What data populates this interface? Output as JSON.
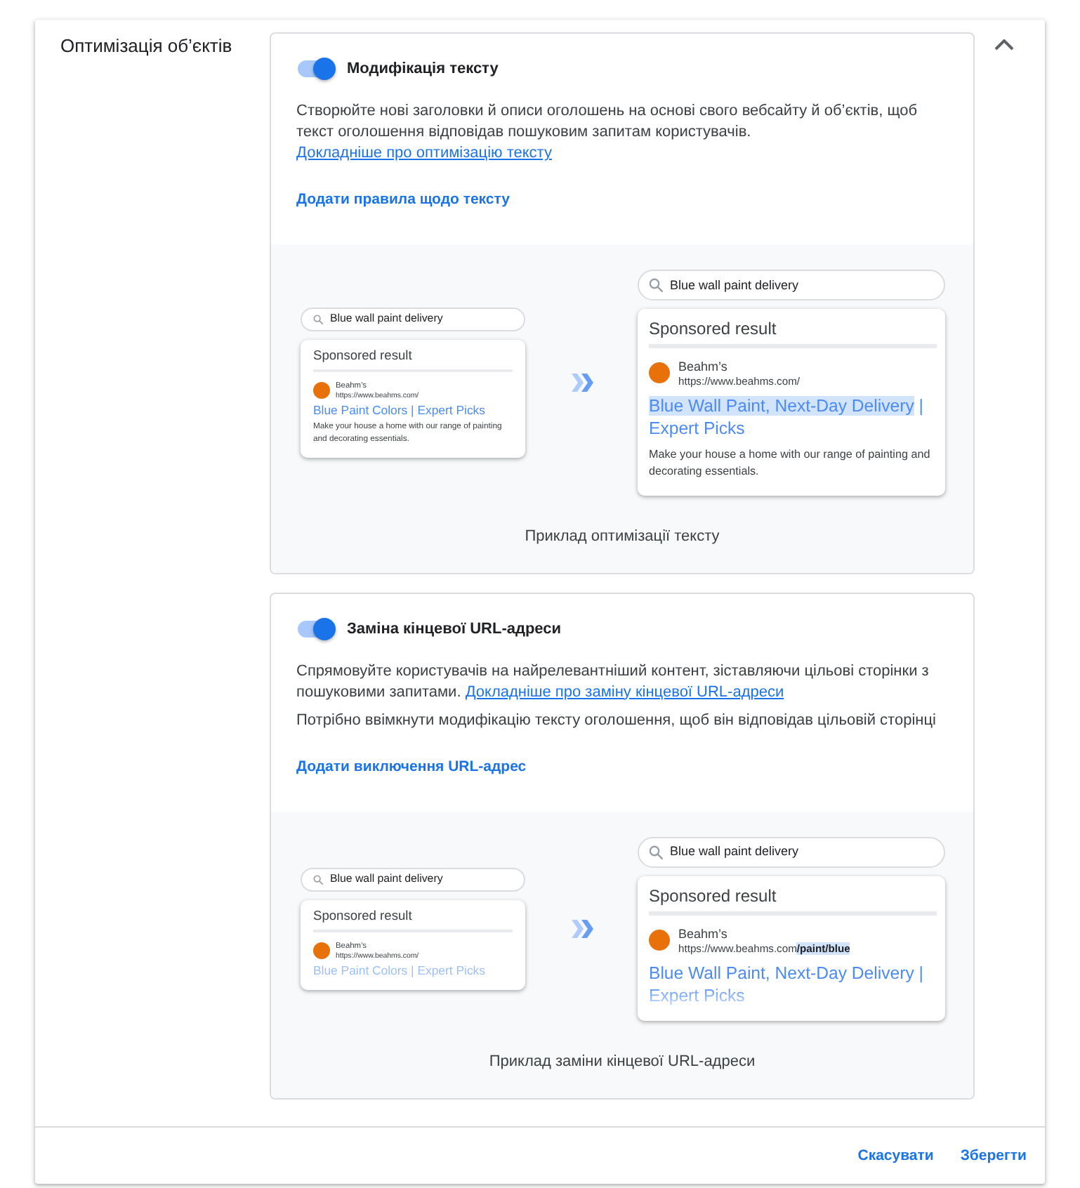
{
  "section": {
    "title": "Оптимізація об’єктів",
    "expanded": true
  },
  "options": [
    {
      "title": "Модифікація тексту",
      "on": true,
      "description": "Створюйте нові заголовки й описи оголошень на основі свого вебсайту й об’єктів, щоб текст оголошення відповідав пошуковим запитам користувачів.",
      "learn_more": "Докладніше про оптимізацію тексту",
      "action": "Додати правила щодо тексту",
      "example": {
        "fade_out": false,
        "before": {
          "query": "Blue wall paint delivery",
          "heading": "Sponsored result",
          "advertiser": "Beahm’s",
          "url": [
            {
              "text": "https://www.beahms.com/",
              "highlighted": false
            }
          ],
          "headline": [
            {
              "text": "Blue Paint Colors | Expert Picks",
              "highlighted": false
            }
          ],
          "body": "Make your house a home with our range of painting and decorating essentials."
        },
        "after": {
          "query": "Blue wall paint delivery",
          "heading": "Sponsored result",
          "advertiser": "Beahm’s",
          "url": [
            {
              "text": "https://www.beahms.com/",
              "highlighted": false
            }
          ],
          "headline": [
            {
              "text": "Blue Wall Paint, Next-Day Delivery",
              "highlighted": true
            },
            {
              "text": "| Expert Picks",
              "highlighted": false
            }
          ],
          "body": "Make your house a home with our range of painting and decorating essentials."
        },
        "caption": "Приклад оптимізації тексту"
      }
    },
    {
      "title": "Заміна кінцевої URL-адреси",
      "on": true,
      "description": "Спрямовуйте користувачів на найрелевантніший контент, зіставляючи цільові сторінки з пошуковими запитами.",
      "learn_more": "Докладніше про заміну кінцевої URL-адреси",
      "note": "Потрібно ввімкнути модифікацію тексту оголошення, щоб він відповідав цільовій сторінці",
      "action": "Додати виключення URL-адрес",
      "example": {
        "fade_out": true,
        "before": {
          "query": "Blue wall paint delivery",
          "heading": "Sponsored result",
          "advertiser": "Beahm’s",
          "url": [
            {
              "text": "https://www.beahms.com/",
              "highlighted": false
            }
          ],
          "headline": [
            {
              "text": "Blue Paint Colors | Expert Picks",
              "highlighted": false
            }
          ]
        },
        "after": {
          "query": "Blue wall paint delivery",
          "heading": "Sponsored result",
          "advertiser": "Beahm’s",
          "url": [
            {
              "text": "https://www.beahms.com",
              "highlighted": false
            },
            {
              "text": "/paint/blue",
              "highlighted": true
            }
          ],
          "headline": [
            {
              "text": "Blue Wall Paint, Next-Day Delivery | Expert Picks",
              "highlighted": false
            }
          ]
        },
        "caption": "Приклад заміни кінцевої URL-адреси"
      }
    }
  ],
  "footer": {
    "buttons": [
      "Скасувати",
      "Зберегти"
    ]
  }
}
